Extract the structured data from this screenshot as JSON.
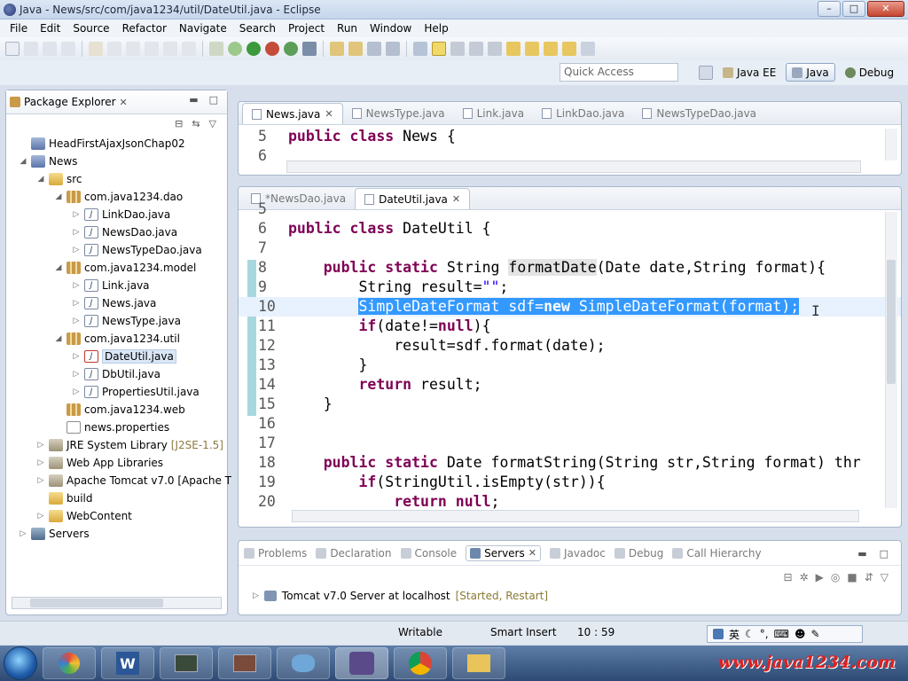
{
  "window": {
    "title": "Java - News/src/com/java1234/util/DateUtil.java - Eclipse",
    "buttons": [
      "–",
      "□",
      "✕"
    ]
  },
  "menu": [
    "File",
    "Edit",
    "Source",
    "Refactor",
    "Navigate",
    "Search",
    "Project",
    "Run",
    "Window",
    "Help"
  ],
  "perspective": {
    "quick_access_placeholder": "Quick Access",
    "items": [
      {
        "label": "Java EE",
        "active": false
      },
      {
        "label": "Java",
        "active": true
      },
      {
        "label": "Debug",
        "active": false
      }
    ]
  },
  "package_explorer": {
    "title": "Package Explorer",
    "tree": [
      {
        "label": "HeadFirstAjaxJsonChap02",
        "level": 0,
        "arrow": "",
        "icon": "project"
      },
      {
        "label": "News",
        "level": 0,
        "arrow": "◢",
        "icon": "project"
      },
      {
        "label": "src",
        "level": 1,
        "arrow": "◢",
        "icon": "folder"
      },
      {
        "label": "com.java1234.dao",
        "level": 2,
        "arrow": "◢",
        "icon": "package"
      },
      {
        "label": "LinkDao.java",
        "level": 3,
        "arrow": "▷",
        "icon": "java"
      },
      {
        "label": "NewsDao.java",
        "level": 3,
        "arrow": "▷",
        "icon": "java"
      },
      {
        "label": "NewsTypeDao.java",
        "level": 3,
        "arrow": "▷",
        "icon": "java"
      },
      {
        "label": "com.java1234.model",
        "level": 2,
        "arrow": "◢",
        "icon": "package"
      },
      {
        "label": "Link.java",
        "level": 3,
        "arrow": "▷",
        "icon": "java"
      },
      {
        "label": "News.java",
        "level": 3,
        "arrow": "▷",
        "icon": "java"
      },
      {
        "label": "NewsType.java",
        "level": 3,
        "arrow": "▷",
        "icon": "java"
      },
      {
        "label": "com.java1234.util",
        "level": 2,
        "arrow": "◢",
        "icon": "package"
      },
      {
        "label": "DateUtil.java",
        "level": 3,
        "arrow": "▷",
        "icon": "java-err",
        "selected": true
      },
      {
        "label": "DbUtil.java",
        "level": 3,
        "arrow": "▷",
        "icon": "java"
      },
      {
        "label": "PropertiesUtil.java",
        "level": 3,
        "arrow": "▷",
        "icon": "java"
      },
      {
        "label": "com.java1234.web",
        "level": 2,
        "arrow": "",
        "icon": "package"
      },
      {
        "label": "news.properties",
        "level": 2,
        "arrow": "",
        "icon": "props"
      },
      {
        "label": "JRE System Library",
        "decor": "[J2SE-1.5]",
        "level": 1,
        "arrow": "▷",
        "icon": "lib"
      },
      {
        "label": "Web App Libraries",
        "level": 1,
        "arrow": "▷",
        "icon": "lib"
      },
      {
        "label": "Apache Tomcat v7.0 [Apache T",
        "level": 1,
        "arrow": "▷",
        "icon": "lib"
      },
      {
        "label": "build",
        "level": 1,
        "arrow": "",
        "icon": "folder"
      },
      {
        "label": "WebContent",
        "level": 1,
        "arrow": "▷",
        "icon": "folder"
      },
      {
        "label": "Servers",
        "level": 0,
        "arrow": "▷",
        "icon": "server"
      }
    ]
  },
  "editor_top": {
    "tabs": [
      {
        "label": "News.java",
        "active": true
      },
      {
        "label": "NewsType.java",
        "active": false
      },
      {
        "label": "Link.java",
        "active": false
      },
      {
        "label": "LinkDao.java",
        "active": false
      },
      {
        "label": "NewsTypeDao.java",
        "active": false
      }
    ],
    "lines": [
      {
        "n": "5",
        "code": "public class News {"
      },
      {
        "n": "6",
        "code": ""
      }
    ]
  },
  "editor_main": {
    "tabs": [
      {
        "label": "*NewsDao.java",
        "active": false
      },
      {
        "label": "DateUtil.java",
        "active": true
      }
    ],
    "lines": [
      {
        "n": "5",
        "code": ""
      },
      {
        "n": "6",
        "code": "public class DateUtil {"
      },
      {
        "n": "7",
        "code": ""
      },
      {
        "n": "8",
        "code": "    public static String formatDate(Date date,String format){"
      },
      {
        "n": "9",
        "code": "        String result=\"\";"
      },
      {
        "n": "10",
        "code": "        SimpleDateFormat sdf=new SimpleDateFormat(format);"
      },
      {
        "n": "11",
        "code": "        if(date!=null){"
      },
      {
        "n": "12",
        "code": "            result=sdf.format(date);"
      },
      {
        "n": "13",
        "code": "        }"
      },
      {
        "n": "14",
        "code": "        return result;"
      },
      {
        "n": "15",
        "code": "    }"
      },
      {
        "n": "16",
        "code": ""
      },
      {
        "n": "17",
        "code": ""
      },
      {
        "n": "18",
        "code": "    public static Date formatString(String str,String format) thr"
      },
      {
        "n": "19",
        "code": "        if(StringUtil.isEmpty(str)){"
      },
      {
        "n": "20",
        "code": "            return null;"
      }
    ]
  },
  "bottom_view": {
    "tabs": [
      {
        "label": "Problems",
        "active": false
      },
      {
        "label": "Declaration",
        "active": false
      },
      {
        "label": "Console",
        "active": false
      },
      {
        "label": "Servers",
        "active": true
      },
      {
        "label": "Javadoc",
        "active": false
      },
      {
        "label": "Debug",
        "active": false
      },
      {
        "label": "Call Hierarchy",
        "active": false
      }
    ],
    "server_name": "Tomcat v7.0 Server at localhost",
    "server_state": "[Started, Restart]"
  },
  "status": {
    "mode": "Writable",
    "insert": "Smart Insert",
    "position": "10 : 59",
    "ime": "英"
  },
  "taskbar": {
    "watermark": "www.java1234.com",
    "word_label": "W"
  }
}
